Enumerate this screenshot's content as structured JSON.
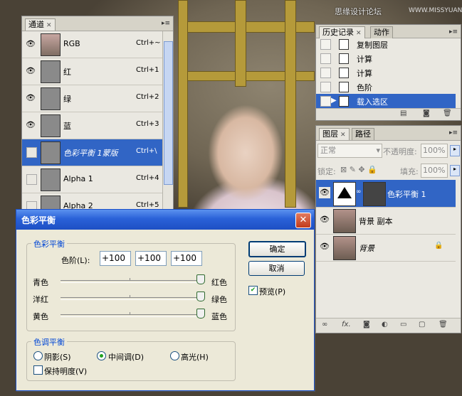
{
  "watermark": {
    "text": "思缘设计论坛",
    "url": "WWW.MISSYUAN.COM"
  },
  "channels_panel": {
    "tab_label": "通道",
    "rows": [
      {
        "name": "RGB",
        "shortcut": "Ctrl+~",
        "visible": true
      },
      {
        "name": "红",
        "shortcut": "Ctrl+1",
        "visible": true
      },
      {
        "name": "绿",
        "shortcut": "Ctrl+2",
        "visible": true
      },
      {
        "name": "蓝",
        "shortcut": "Ctrl+3",
        "visible": true
      },
      {
        "name": "色彩平衡 1蒙版",
        "shortcut": "Ctrl+\\",
        "visible": false,
        "selected": true
      },
      {
        "name": "Alpha 1",
        "shortcut": "Ctrl+4",
        "visible": false
      },
      {
        "name": "Alpha 2",
        "shortcut": "Ctrl+5",
        "visible": false
      }
    ]
  },
  "history_panel": {
    "tabs": [
      "历史记录",
      "动作"
    ],
    "items": [
      {
        "label": "复制图层"
      },
      {
        "label": "计算"
      },
      {
        "label": "计算"
      },
      {
        "label": "色阶"
      },
      {
        "label": "载入选区",
        "selected": true
      }
    ]
  },
  "layers_panel": {
    "tabs": [
      "图层",
      "路径"
    ],
    "blend_mode": "正常",
    "opacity_label": "不透明度:",
    "opacity_value": "100%",
    "lock_label": "锁定:",
    "fill_label": "填充:",
    "fill_value": "100%",
    "layers": [
      {
        "name": "色彩平衡 1",
        "selected": true
      },
      {
        "name": "背景 副本"
      },
      {
        "name": "背景",
        "locked": true
      }
    ]
  },
  "dialog": {
    "title": "色彩平衡",
    "group_balance": "色彩平衡",
    "levels_label": "色阶(L):",
    "levels": [
      "+100",
      "+100",
      "+100"
    ],
    "sliders": [
      {
        "left": "青色",
        "right": "红色",
        "value": 100
      },
      {
        "left": "洋红",
        "right": "绿色",
        "value": 100
      },
      {
        "left": "黄色",
        "right": "蓝色",
        "value": 100
      }
    ],
    "group_tone": "色调平衡",
    "tones": [
      {
        "label": "阴影(S)",
        "checked": false
      },
      {
        "label": "中间调(D)",
        "checked": true
      },
      {
        "label": "高光(H)",
        "checked": false
      }
    ],
    "preserve_label": "保持明度(V)",
    "preserve_checked": false,
    "ok_label": "确定",
    "cancel_label": "取消",
    "preview_label": "预览(P)",
    "preview_checked": true
  }
}
